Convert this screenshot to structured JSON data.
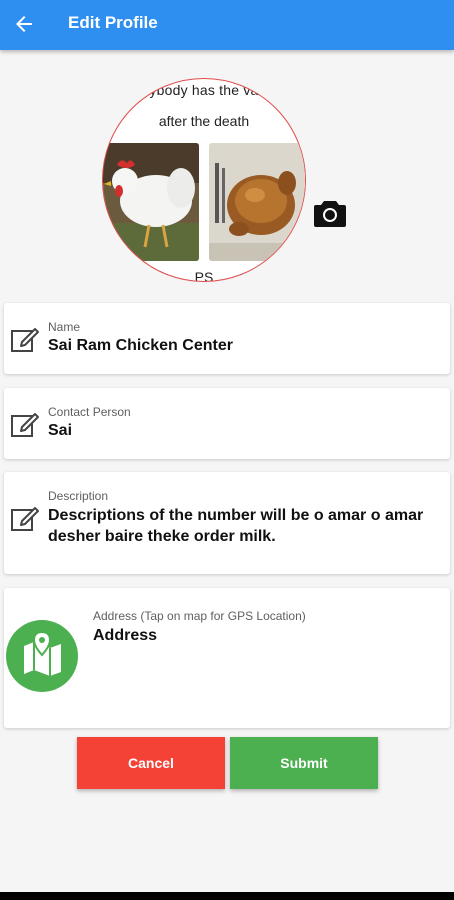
{
  "appbar": {
    "title": "Edit Profile",
    "back_icon": "arrow-back-icon",
    "color": "#2f8ff0"
  },
  "profile_image": {
    "caption_top": "ybody has the va",
    "caption_mid": "after the death",
    "caption_bottom": "PS",
    "camera_icon": "camera-icon"
  },
  "fields": {
    "name": {
      "label": "Name",
      "value": "Sai Ram Chicken Center"
    },
    "contact": {
      "label": "Contact Person",
      "value": "Sai"
    },
    "description": {
      "label": "Description",
      "value": "Descriptions of the number will be o amar o amar desher baire theke order milk."
    },
    "address": {
      "label": "Address (Tap on map for GPS Location)",
      "value": "Address",
      "icon": "map-pin-icon"
    }
  },
  "actions": {
    "cancel_label": "Cancel",
    "submit_label": "Submit",
    "cancel_color": "#f44336",
    "submit_color": "#4caf50"
  }
}
